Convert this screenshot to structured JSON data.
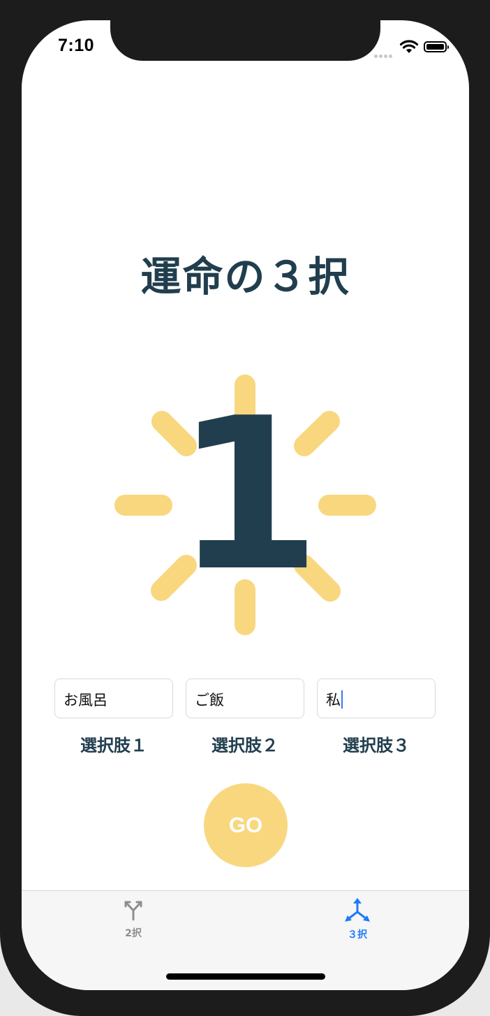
{
  "status_bar": {
    "time": "7:10"
  },
  "main": {
    "title": "運命の３択",
    "result_number": "1",
    "choices": [
      {
        "value": "お風呂",
        "label": "選択肢１"
      },
      {
        "value": "ご飯",
        "label": "選択肢２"
      },
      {
        "value": "私",
        "label": "選択肢３"
      }
    ],
    "go_label": "GO"
  },
  "tab_bar": {
    "tabs": [
      {
        "label": "2択",
        "icon": "two-way-branch-icon",
        "selected": false
      },
      {
        "label": "３択",
        "icon": "three-way-branch-icon",
        "selected": true
      }
    ]
  },
  "colors": {
    "title": "#213e4e",
    "accent": "#f8d77f",
    "tab_selected": "#1f7cf6",
    "tab_unselected": "#8e8e8e"
  }
}
